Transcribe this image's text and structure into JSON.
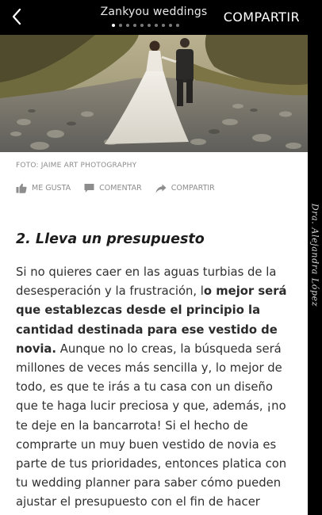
{
  "topbar": {
    "title": "Zankyou weddings",
    "share_label": "COMPARTIR",
    "dots_count": 10,
    "active_dot": 0
  },
  "photo": {
    "credit": "FOTO: JAIME ART PHOTOGRAPHY"
  },
  "actions": {
    "like": "ME GUSTA",
    "comment": "COMENTAR",
    "share": "COMPARTIR"
  },
  "article": {
    "heading": "2. Lleva un presupuesto",
    "p1": "Si no quieres caer en las aguas turbias de la desesperación y la frustración, l",
    "p1_bold": "o mejor será que establezcas desde el principio la cantidad destinada para ese vestido de novia.",
    "p1_rest": " Aunque no lo creas, la búsqueda será millones de veces más sencilla y, lo mejor de todo, es que te irás a tu casa con un diseño que te haga lucir preciosa y que, además, ¡no te deje en la bancarrota! Si el hecho de comprarte un muy buen vestido de novia es parte de tus prioridades, entonces platica con tu wedding planner para saber cómo pueden ajustar el presupuesto con el fin de hacer realidad tu más grande sueño."
  },
  "watermark": {
    "signature": "Dra. Alejandra López"
  },
  "colors": {
    "bar": "#000000",
    "muted": "#8d8d8d",
    "text": "#303030"
  }
}
